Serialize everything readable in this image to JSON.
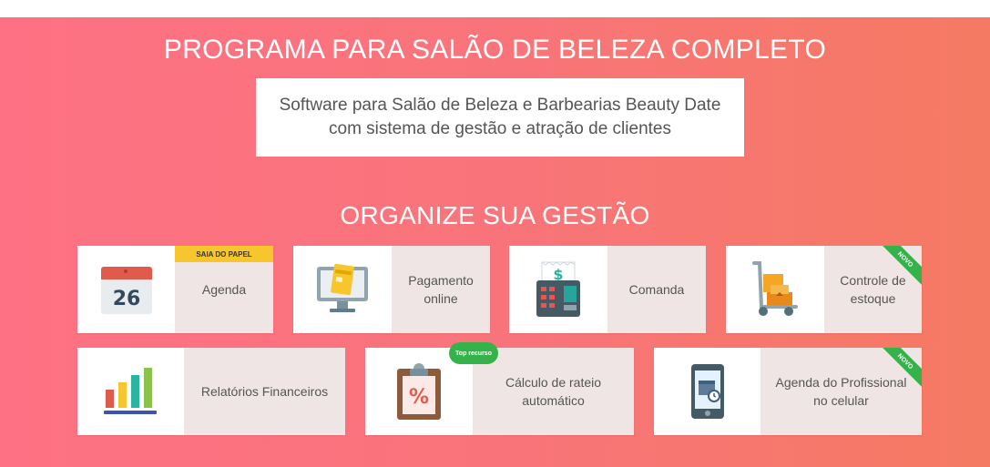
{
  "header": {
    "title": "PROGRAMA PARA SALÃO DE BELEZA COMPLETO",
    "subtitle": "Software para Salão de Beleza e Barbearias Beauty Date com sistema de gestão e atração de clientes"
  },
  "section": {
    "title": "ORGANIZE SUA GESTÃO"
  },
  "features": [
    {
      "label": "Agenda",
      "icon": "calendar-icon",
      "badge": "SAIA DO PAPEL",
      "calendar_day": "26"
    },
    {
      "label": "Pagamento online",
      "icon": "online-payment-icon"
    },
    {
      "label": "Comanda",
      "icon": "cash-register-icon"
    },
    {
      "label": "Controle de estoque",
      "icon": "stock-cart-icon",
      "badge": "NOVO"
    },
    {
      "label": "Relatórios Financeiros",
      "icon": "bar-chart-icon"
    },
    {
      "label": "Cálculo de rateio automático",
      "icon": "percent-clipboard-icon",
      "badge": "Top recurso"
    },
    {
      "label": "Agenda do Profissional no celular",
      "icon": "mobile-calendar-icon",
      "badge": "NOVO"
    }
  ],
  "colors": {
    "gradient_left": "#fe7184",
    "gradient_right": "#f57a63",
    "card_label_bg": "#f0e5e5",
    "badge_yellow": "#f7c52d",
    "badge_green": "#35b34a"
  }
}
